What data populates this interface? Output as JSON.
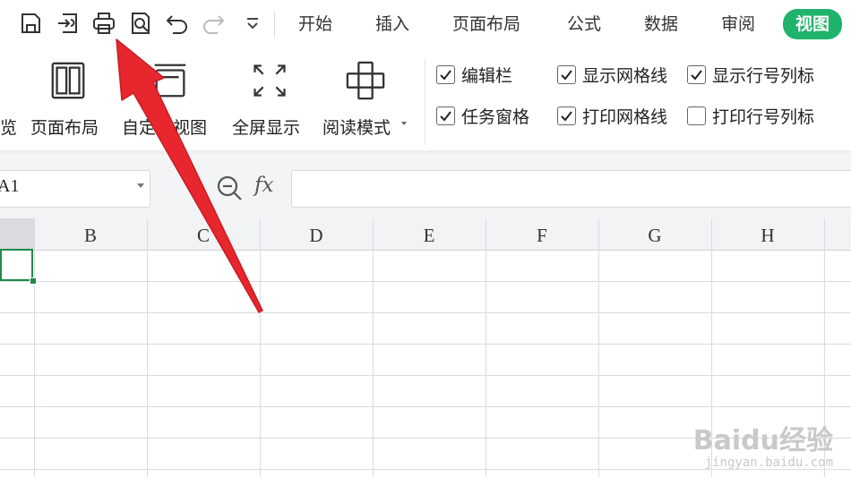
{
  "menu_tabs": [
    {
      "label": "开始"
    },
    {
      "label": "插入"
    },
    {
      "label": "页面布局"
    },
    {
      "label": "公式"
    },
    {
      "label": "数据"
    },
    {
      "label": "审阅"
    },
    {
      "label": "视图",
      "active": true
    }
  ],
  "ribbon": {
    "partial_label": "览",
    "buttons": [
      {
        "label": "页面布局",
        "icon": "page-layout-icon"
      },
      {
        "label": "自定义视图",
        "icon": "custom-view-icon"
      },
      {
        "label": "全屏显示",
        "icon": "fullscreen-icon"
      },
      {
        "label": "阅读模式",
        "icon": "reading-mode-icon"
      }
    ],
    "checkboxes": [
      {
        "label": "编辑栏",
        "checked": true
      },
      {
        "label": "显示网格线",
        "checked": true
      },
      {
        "label": "显示行号列标",
        "checked": true
      },
      {
        "label": "任务窗格",
        "checked": true
      },
      {
        "label": "打印网格线",
        "checked": true
      },
      {
        "label": "打印行号列标",
        "checked": false
      }
    ]
  },
  "formula_bar": {
    "cell_ref": "A1",
    "fx_label": "fx",
    "value": ""
  },
  "sheet": {
    "columns": [
      "B",
      "C",
      "D",
      "E",
      "F",
      "G",
      "H"
    ]
  },
  "watermark": {
    "main": "Baidu经验",
    "sub": "jingyan.baidu.com"
  },
  "colors": {
    "accent": "#1fb36b",
    "selection": "#1e8a4a",
    "annotation_arrow": "#e8262d"
  }
}
